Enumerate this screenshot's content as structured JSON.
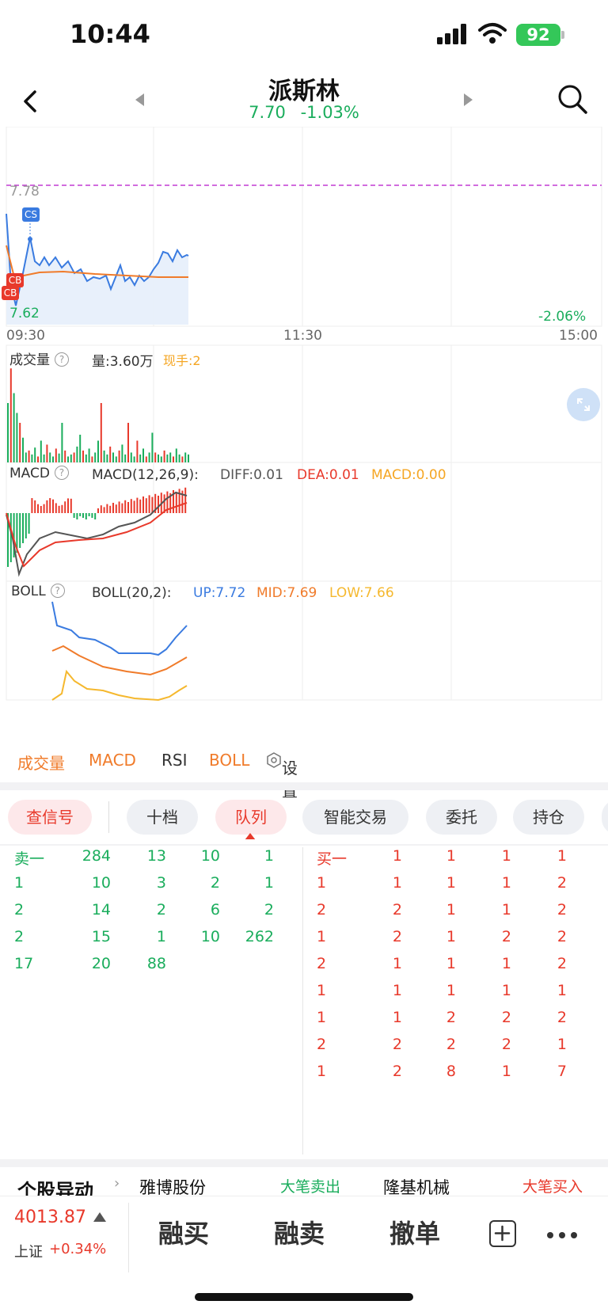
{
  "status_bar": {
    "time": "10:44",
    "battery": "92"
  },
  "header": {
    "stock_name": "派斯林",
    "price": "7.70",
    "change_pct": "-1.03%"
  },
  "chart": {
    "high_label": "7.78",
    "low_label": "7.62",
    "right_pct": "-2.06%",
    "markers": {
      "cs": "CS",
      "cb1": "CB",
      "cb2": "CB"
    },
    "time_axis": [
      "09:30",
      "11:30",
      "15:00"
    ],
    "volume": {
      "title": "成交量",
      "info": "?",
      "vol": "量:3.60万",
      "now": "现手:2"
    },
    "macd": {
      "title": "MACD",
      "info": "?",
      "params": "MACD(12,26,9):",
      "diff": "DIFF:0.01",
      "dea": "DEA:0.01",
      "macd": "MACD:0.00"
    },
    "boll": {
      "title": "BOLL",
      "info": "?",
      "params": "BOLL(20,2):",
      "up": "UP:7.72",
      "mid": "MID:7.69",
      "low": "LOW:7.66"
    },
    "colors": {
      "price": "#3a7be0",
      "avg": "#f07b2a",
      "up": "#e8392b",
      "down": "#1aad5c",
      "boll_low": "#f5b82e"
    }
  },
  "indicator_tabs": [
    "成交量",
    "MACD",
    "RSI",
    "BOLL",
    "设置"
  ],
  "pill_tabs": [
    "查信号",
    "十档",
    "队列",
    "智能交易",
    "委托",
    "持仓"
  ],
  "queue": {
    "sell_label": "卖一",
    "buy_label": "买一",
    "sell_rows": [
      [
        "284",
        "13",
        "10",
        "1"
      ],
      [
        "1",
        "10",
        "3",
        "2",
        "1"
      ],
      [
        "2",
        "14",
        "2",
        "6",
        "2"
      ],
      [
        "2",
        "15",
        "1",
        "10",
        "262"
      ],
      [
        "17",
        "20",
        "88"
      ]
    ],
    "buy_rows": [
      [
        "1",
        "1",
        "1",
        "1"
      ],
      [
        "1",
        "1",
        "1",
        "1",
        "2"
      ],
      [
        "2",
        "2",
        "1",
        "1",
        "2"
      ],
      [
        "1",
        "2",
        "1",
        "2",
        "2"
      ],
      [
        "2",
        "1",
        "1",
        "1",
        "2"
      ],
      [
        "1",
        "1",
        "1",
        "1",
        "1"
      ],
      [
        "1",
        "1",
        "2",
        "2",
        "2"
      ],
      [
        "2",
        "2",
        "2",
        "2",
        "1"
      ],
      [
        "1",
        "2",
        "8",
        "1",
        "7"
      ]
    ]
  },
  "news": [
    "个股异动",
    "雅博股份",
    "大笔卖出",
    "隆基机械",
    "大笔买入"
  ],
  "bottom": {
    "index_value": "4013.87",
    "index_name": "上证",
    "index_change": "+0.34%",
    "actions": [
      "融买",
      "融卖",
      "撤单"
    ]
  }
}
